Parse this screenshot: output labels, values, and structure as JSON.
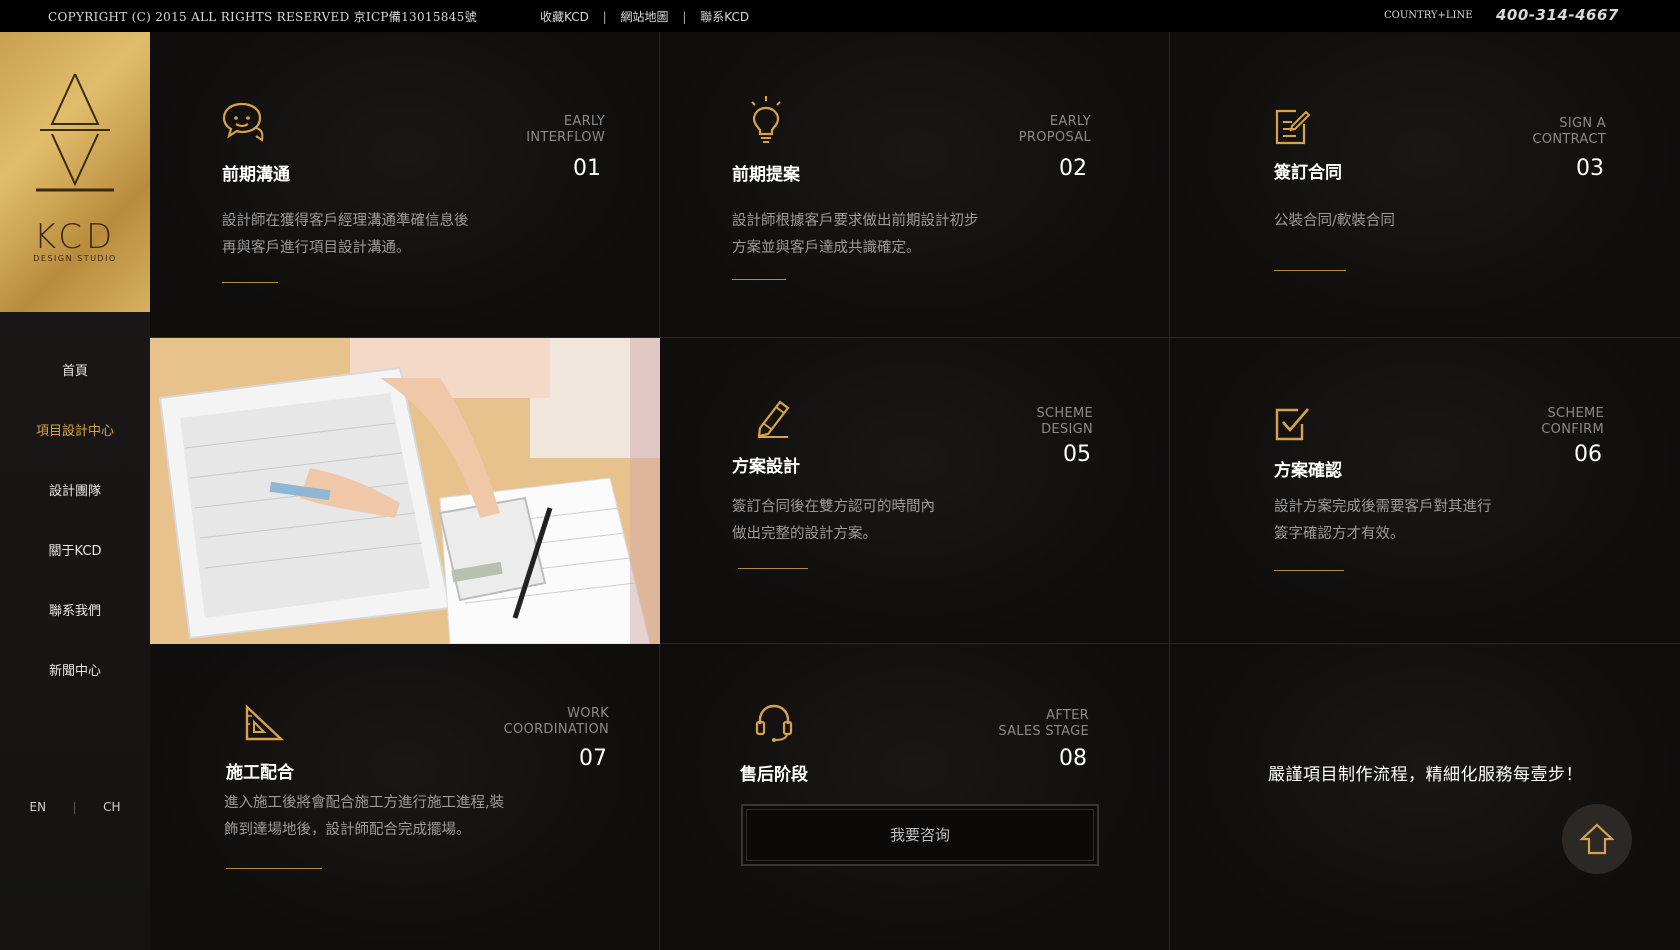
{
  "topbar": {
    "copyright": "COPYRIGHT (C) 2015 ALL RIGHTS RESERVED  京ICP備13015845號",
    "links": [
      "收藏KCD",
      "網站地圖",
      "聯系KCD"
    ],
    "separator": "|",
    "country_line": "COUNTRY+LINE",
    "phone": "400-314-4667"
  },
  "logo": {
    "name": "KCD",
    "subtitle": "DESIGN STUDIO"
  },
  "nav": {
    "items": [
      "首頁",
      "項目設計中心",
      "設計團隊",
      "關于KCD",
      "聯系我們",
      "新聞中心"
    ],
    "active_index": 1
  },
  "lang": {
    "en": "EN",
    "ch": "CH"
  },
  "steps": [
    {
      "title": "前期溝通",
      "en1": "EARLY",
      "en2": "INTERFLOW",
      "num": "01",
      "desc1": "設計師在獲得客戶經理溝通準確信息後",
      "desc2": "再與客戶進行項目設計溝通。",
      "icon": "chat-icon"
    },
    {
      "title": "前期提案",
      "en1": "EARLY",
      "en2": "PROPOSAL",
      "num": "02",
      "desc1": "設計師根據客戶要求做出前期設計初步",
      "desc2": "方案並與客戶達成共識確定。",
      "icon": "lightbulb-icon"
    },
    {
      "title": "簽訂合同",
      "en1": "SIGN A",
      "en2": "CONTRACT",
      "num": "03",
      "desc1": "公裝合同/軟裝合同",
      "desc2": "",
      "icon": "contract-icon"
    },
    {
      "title": "方案設計",
      "en1": "SCHEME",
      "en2": "DESIGN",
      "num": "05",
      "desc1": "簽訂合同後在雙方認可的時間內",
      "desc2": "做出完整的設計方案。",
      "icon": "pencil-icon"
    },
    {
      "title": "方案確認",
      "en1": "SCHEME",
      "en2": "CONFIRM",
      "num": "06",
      "desc1": "設計方案完成後需要客戶對其進行",
      "desc2": "簽字確認方才有效。",
      "icon": "checkbox-icon"
    },
    {
      "title": "施工配合",
      "en1": "WORK",
      "en2": "COORDINATION",
      "num": "07",
      "desc1": "進入施工後將會配合施工方進行施工進程,裝",
      "desc2": "飾到達場地後，設計師配合完成擺場。",
      "icon": "triangle-ruler-icon"
    },
    {
      "title": "售后阶段",
      "en1": "AFTER",
      "en2": "SALES STAGE",
      "num": "08",
      "desc1": "",
      "desc2": "",
      "icon": "headset-icon"
    }
  ],
  "consult_button": "我要咨询",
  "slogan": "嚴謹項目制作流程，精細化服務每壹步！",
  "colors": {
    "gold": "#d7a24a",
    "background": "#0b0a09"
  }
}
